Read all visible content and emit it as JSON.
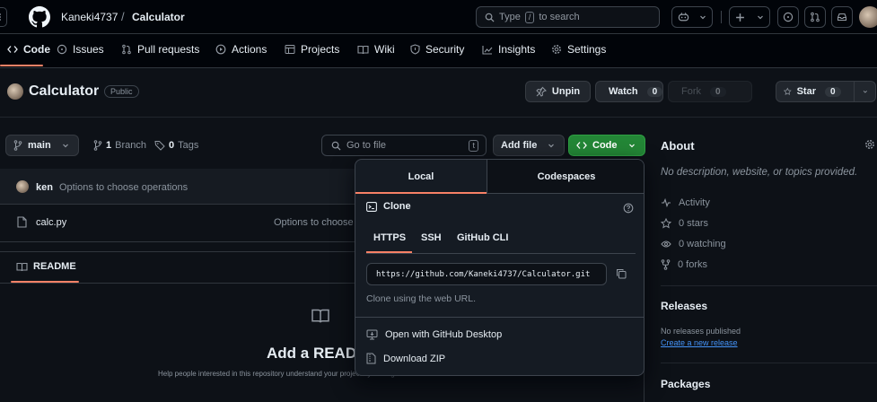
{
  "header": {
    "owner": "Kaneki4737",
    "separator": "/",
    "repo": "Calculator",
    "search_placeholder_prefix": "Type",
    "search_key": "/",
    "search_placeholder_suffix": "to search"
  },
  "nav": {
    "tabs": [
      {
        "label": "Code",
        "icon": "code-icon"
      },
      {
        "label": "Issues",
        "icon": "issue-icon"
      },
      {
        "label": "Pull requests",
        "icon": "pull-request-icon"
      },
      {
        "label": "Actions",
        "icon": "play-icon"
      },
      {
        "label": "Projects",
        "icon": "table-icon"
      },
      {
        "label": "Wiki",
        "icon": "book-icon"
      },
      {
        "label": "Security",
        "icon": "shield-icon"
      },
      {
        "label": "Insights",
        "icon": "graph-icon"
      },
      {
        "label": "Settings",
        "icon": "gear-icon"
      }
    ]
  },
  "repo_header": {
    "name": "Calculator",
    "visibility": "Public",
    "unpin_label": "Unpin",
    "watch_label": "Watch",
    "watch_count": "0",
    "fork_label": "Fork",
    "fork_count": "0",
    "star_label": "Star",
    "star_count": "0"
  },
  "toolbar": {
    "branch": "main",
    "branch_count": "1",
    "branch_label": "Branch",
    "tag_count": "0",
    "tag_label": "Tags",
    "goto_file_placeholder": "Go to file",
    "goto_key": "t",
    "add_file_label": "Add file",
    "code_label": "Code"
  },
  "commit": {
    "author": "ken",
    "message": "Options to choose operations"
  },
  "files": [
    {
      "name": "calc.py",
      "message": "Options to choose"
    }
  ],
  "readme": {
    "tab_label": "README",
    "heading": "Add a READ",
    "subtext": "Help people interested in this repository understand your project by adding a README."
  },
  "clone_dropdown": {
    "tabs": [
      "Local",
      "Codespaces"
    ],
    "clone_title": "Clone",
    "protocols": [
      "HTTPS",
      "SSH",
      "GitHub CLI"
    ],
    "url": "https://github.com/Kaneki4737/Calculator.git",
    "hint": "Clone using the web URL.",
    "open_desktop": "Open with GitHub Desktop",
    "download_zip": "Download ZIP"
  },
  "about": {
    "title": "About",
    "description": "No description, website, or topics provided.",
    "stats": [
      {
        "icon": "pulse-icon",
        "label": "Activity"
      },
      {
        "icon": "star-icon",
        "label": "0 stars"
      },
      {
        "icon": "eye-icon",
        "label": "0 watching"
      },
      {
        "icon": "fork-icon",
        "label": "0 forks"
      }
    ],
    "releases_title": "Releases",
    "releases_text": "No releases published",
    "releases_link": "Create a new release",
    "packages_title": "Packages"
  },
  "colors": {
    "background": "#0d1117",
    "accent_green": "#238636",
    "link_blue": "#4493f8",
    "tab_underline": "#f78166"
  }
}
